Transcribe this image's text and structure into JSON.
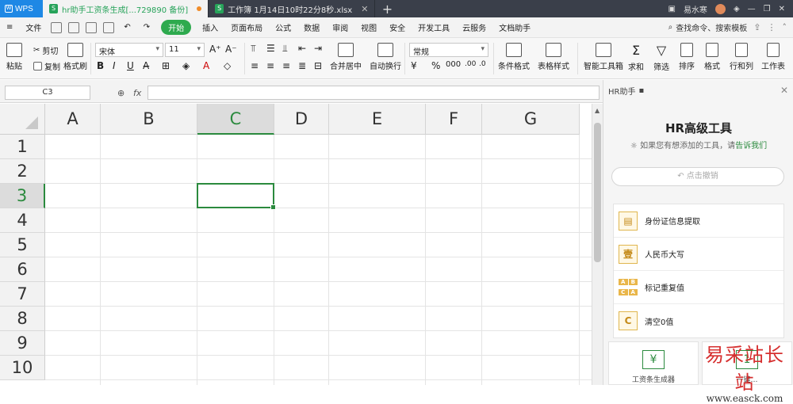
{
  "titlebar": {
    "app_name": "WPS",
    "tabs": [
      {
        "label": "hr助手工资条生成[...729890 备份]",
        "active": true,
        "icon": "spreadsheet-icon"
      },
      {
        "label": "工作簿 1月14日10时22分8秒.xlsx",
        "active": false,
        "icon": "spreadsheet-icon"
      }
    ],
    "user_name": "易水寒"
  },
  "menubar": {
    "file": "文件",
    "items": [
      "开始",
      "插入",
      "页面布局",
      "公式",
      "数据",
      "审阅",
      "视图",
      "安全",
      "开发工具",
      "云服务",
      "文档助手"
    ],
    "search": "查找命令、搜索模板"
  },
  "ribbon": {
    "paste": "粘贴",
    "cut": "剪切",
    "copy": "复制",
    "format_painter": "格式刷",
    "font_name": "宋体",
    "font_size": "11",
    "merge_center": "合并居中",
    "wrap_text": "自动换行",
    "number_format": "常规",
    "conditional_format": "条件格式",
    "table_style": "表格样式",
    "smart_toolbox": "智能工具箱",
    "sum": "求和",
    "filter": "筛选",
    "sort": "排序",
    "format": "格式",
    "row_col": "行和列",
    "worksheet": "工作表"
  },
  "formula": {
    "name_box": "C3",
    "fx": "fx"
  },
  "sheet": {
    "columns": [
      "A",
      "B",
      "C",
      "D",
      "E",
      "F",
      "G"
    ],
    "rows": [
      "1",
      "2",
      "3",
      "4",
      "5",
      "6",
      "7",
      "8",
      "9",
      "10"
    ],
    "selected_cell": "C3",
    "accent": "#2b8a3e"
  },
  "pane": {
    "header": "HR助手",
    "title": "HR高级工具",
    "subtitle": "如果您有想添加的工具，请",
    "subtitle_link": "告诉我们",
    "undo": "点击撤销",
    "tools": [
      {
        "label": "身份证信息提取",
        "icon": "id-card-icon"
      },
      {
        "label": "人民币大写",
        "icon": "rmb-uppercase-icon",
        "glyph": "壹"
      },
      {
        "label": "标记重复值",
        "icon": "duplicate-mark-icon"
      },
      {
        "label": "清空0值",
        "icon": "clear-zero-icon",
        "glyph": "C"
      }
    ],
    "cards": [
      {
        "label": "工资条生成器",
        "glyph": "¥"
      },
      {
        "label": "一键…",
        "glyph": "1"
      }
    ]
  },
  "watermark": {
    "text": "易采站长站",
    "url": "www.easck.com"
  }
}
